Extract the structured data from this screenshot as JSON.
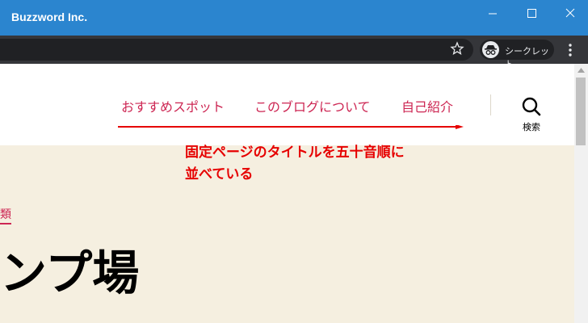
{
  "window": {
    "title": "Buzzword Inc."
  },
  "browser": {
    "incognito_label": "シークレット"
  },
  "nav": {
    "items": [
      {
        "label": "おすすめスポット"
      },
      {
        "label": "このブログについて"
      },
      {
        "label": "自己紹介"
      }
    ],
    "search_label": "検索"
  },
  "annotation": {
    "line1": "固定ページのタイトルを五十音順に",
    "line2": "並べている"
  },
  "content": {
    "category": "類",
    "heading": "ンプ場"
  },
  "colors": {
    "titlebar": "#2b85cf",
    "accent": "#cd2653",
    "annotation": "#e60000",
    "content_bg": "#f5efe0"
  }
}
